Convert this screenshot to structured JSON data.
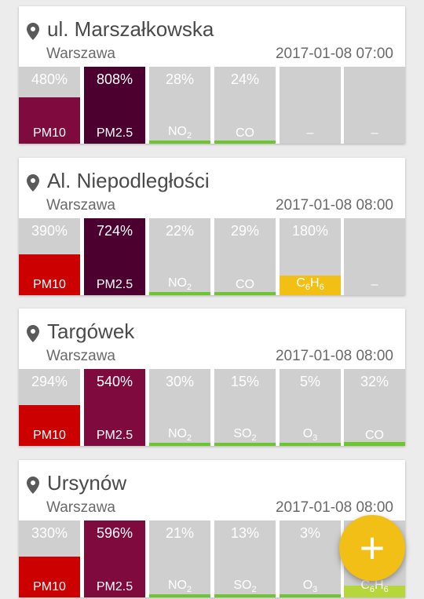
{
  "colors": {
    "tile_bg": "#cfcfcf",
    "good": "#6cc72e",
    "moderate": "#b6d63c",
    "warning": "#f2c014",
    "bad": "#cc0000",
    "very_bad": "#7f0a3e",
    "extreme": "#4c0030",
    "fab": "#f2bf16"
  },
  "fab": {
    "label": "+"
  },
  "stations": [
    {
      "name": "ul. Marszałkowska",
      "city": "Warszawa",
      "time": "2017-01-08 07:00",
      "tiles": [
        {
          "value": "480%",
          "label": "PM10",
          "level": 0.6,
          "color": "#7f0a3e"
        },
        {
          "value": "808%",
          "label": "PM2.5",
          "level": 1.0,
          "color": "#4c0030"
        },
        {
          "value": "28%",
          "label": "NO",
          "sub": "2",
          "level": 0.03,
          "color": "#6cc72e"
        },
        {
          "value": "24%",
          "label": "CO",
          "level": 0.03,
          "color": "#6cc72e"
        },
        {
          "value": "",
          "label": "–",
          "level": 0,
          "color": "#cfcfcf"
        },
        {
          "value": "",
          "label": "–",
          "level": 0,
          "color": "#cfcfcf"
        }
      ]
    },
    {
      "name": "Al. Niepodległości",
      "city": "Warszawa",
      "time": "2017-01-08 08:00",
      "tiles": [
        {
          "value": "390%",
          "label": "PM10",
          "level": 0.53,
          "color": "#cc0000"
        },
        {
          "value": "724%",
          "label": "PM2.5",
          "level": 1.0,
          "color": "#4c0030"
        },
        {
          "value": "22%",
          "label": "NO",
          "sub": "2",
          "level": 0.03,
          "color": "#6cc72e"
        },
        {
          "value": "29%",
          "label": "CO",
          "level": 0.03,
          "color": "#6cc72e"
        },
        {
          "value": "180%",
          "label": "C",
          "sub": "6",
          "label2": "H",
          "sub2": "6",
          "level": 0.25,
          "color": "#f2c014"
        },
        {
          "value": "",
          "label": "–",
          "level": 0,
          "color": "#cfcfcf"
        }
      ]
    },
    {
      "name": "Targówek",
      "city": "Warszawa",
      "time": "2017-01-08 08:00",
      "tiles": [
        {
          "value": "294%",
          "label": "PM10",
          "level": 0.53,
          "color": "#cc0000"
        },
        {
          "value": "540%",
          "label": "PM2.5",
          "level": 1.0,
          "color": "#7f0a3e"
        },
        {
          "value": "30%",
          "label": "NO",
          "sub": "2",
          "level": 0.03,
          "color": "#6cc72e"
        },
        {
          "value": "15%",
          "label": "SO",
          "sub": "2",
          "level": 0.03,
          "color": "#6cc72e"
        },
        {
          "value": "5%",
          "label": "O",
          "sub": "3",
          "level": 0.01,
          "color": "#6cc72e"
        },
        {
          "value": "32%",
          "label": "CO",
          "level": 0.05,
          "color": "#6cc72e"
        }
      ]
    },
    {
      "name": "Ursynów",
      "city": "Warszawa",
      "time": "2017-01-08 08:00",
      "tiles": [
        {
          "value": "330%",
          "label": "PM10",
          "level": 0.53,
          "color": "#cc0000"
        },
        {
          "value": "596%",
          "label": "PM2.5",
          "level": 1.0,
          "color": "#7f0a3e"
        },
        {
          "value": "21%",
          "label": "NO",
          "sub": "2",
          "level": 0.03,
          "color": "#6cc72e"
        },
        {
          "value": "13%",
          "label": "SO",
          "sub": "2",
          "level": 0.03,
          "color": "#6cc72e"
        },
        {
          "value": "3%",
          "label": "O",
          "sub": "3",
          "level": 0.01,
          "color": "#6cc72e"
        },
        {
          "value": "",
          "label": "C",
          "sub": "6",
          "label2": "H",
          "sub2": "6",
          "level": 0.15,
          "color": "#b6d63c"
        }
      ]
    }
  ]
}
